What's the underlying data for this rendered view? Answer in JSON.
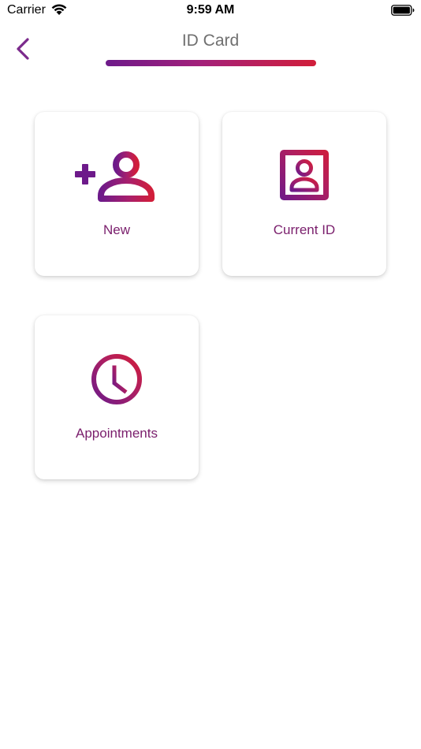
{
  "status_bar": {
    "carrier": "Carrier",
    "time": "9:59 AM"
  },
  "header": {
    "title": "ID Card",
    "back_icon": "chevron-left-icon"
  },
  "tiles": [
    {
      "label": "New",
      "icon": "add-person-icon"
    },
    {
      "label": "Current ID",
      "icon": "id-portrait-icon"
    },
    {
      "label": "Appointments",
      "icon": "clock-icon"
    }
  ],
  "colors": {
    "accent_purple": "#6d1a8a",
    "accent_red": "#d11e3a",
    "label_color": "#7a1e6c",
    "title_color": "#6f6f6f"
  }
}
